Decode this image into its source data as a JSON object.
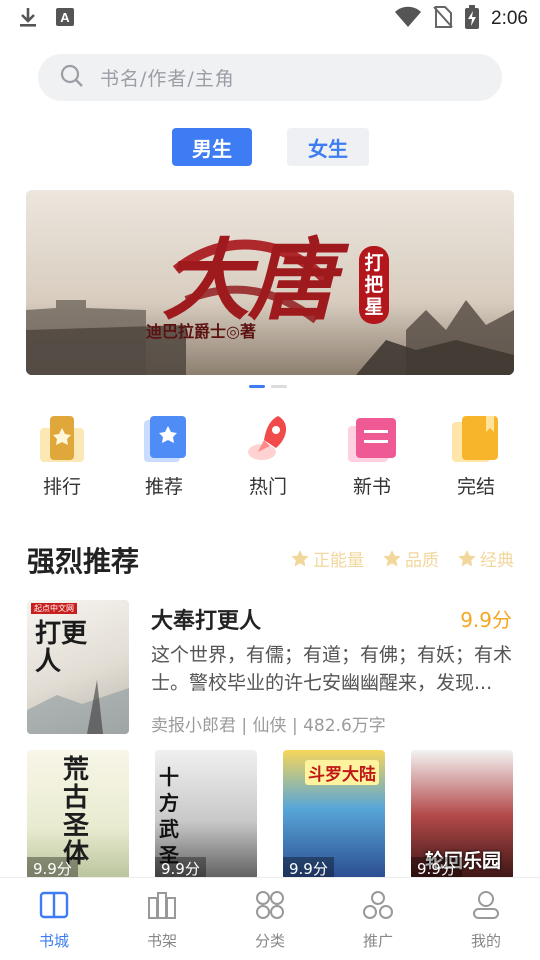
{
  "status_bar": {
    "time": "2:06"
  },
  "search": {
    "placeholder": "书名/作者/主角"
  },
  "gender_tabs": [
    {
      "label": "男生",
      "active": true
    },
    {
      "label": "女生",
      "active": false
    }
  ],
  "banner": {
    "title": "大唐",
    "subtitle": "打把星",
    "author": "迪巴拉爵士◎著",
    "pages": 2,
    "current_page": 0
  },
  "categories": [
    {
      "label": "排行",
      "icon": "trophy-icon"
    },
    {
      "label": "推荐",
      "icon": "recommend-icon"
    },
    {
      "label": "热门",
      "icon": "rocket-icon"
    },
    {
      "label": "新书",
      "icon": "new-book-icon"
    },
    {
      "label": "完结",
      "icon": "finished-icon"
    }
  ],
  "section": {
    "title": "强烈推荐",
    "tags": [
      "正能量",
      "品质",
      "经典"
    ]
  },
  "featured": {
    "title": "大奉打更人",
    "score": "9.9分",
    "description": "这个世界，有儒；有道；有佛；有妖；有术士。警校毕业的许七安幽幽醒来，发现...",
    "author": "卖报小郎君",
    "genre": "仙侠",
    "word_count": "482.6万字",
    "separator": "|",
    "cover_text": "打更人",
    "cover_badge": "起点中文网"
  },
  "grid_books": [
    {
      "cover_text": "荒古圣体",
      "score": "9.9分"
    },
    {
      "cover_text": "十方武圣",
      "score": "9.9分"
    },
    {
      "cover_text": "斗罗大陆",
      "score": "9.9分"
    },
    {
      "cover_text": "轮回乐园",
      "score": "9.9分"
    }
  ],
  "bottom_nav": [
    {
      "label": "书城",
      "icon": "bookstore-icon",
      "active": true
    },
    {
      "label": "书架",
      "icon": "bookshelf-icon",
      "active": false
    },
    {
      "label": "分类",
      "icon": "category-icon",
      "active": false
    },
    {
      "label": "推广",
      "icon": "share-icon",
      "active": false
    },
    {
      "label": "我的",
      "icon": "profile-icon",
      "active": false
    }
  ],
  "colors": {
    "accent": "#3d7cf3",
    "score": "#f5a623",
    "tag": "#f2d79c"
  }
}
